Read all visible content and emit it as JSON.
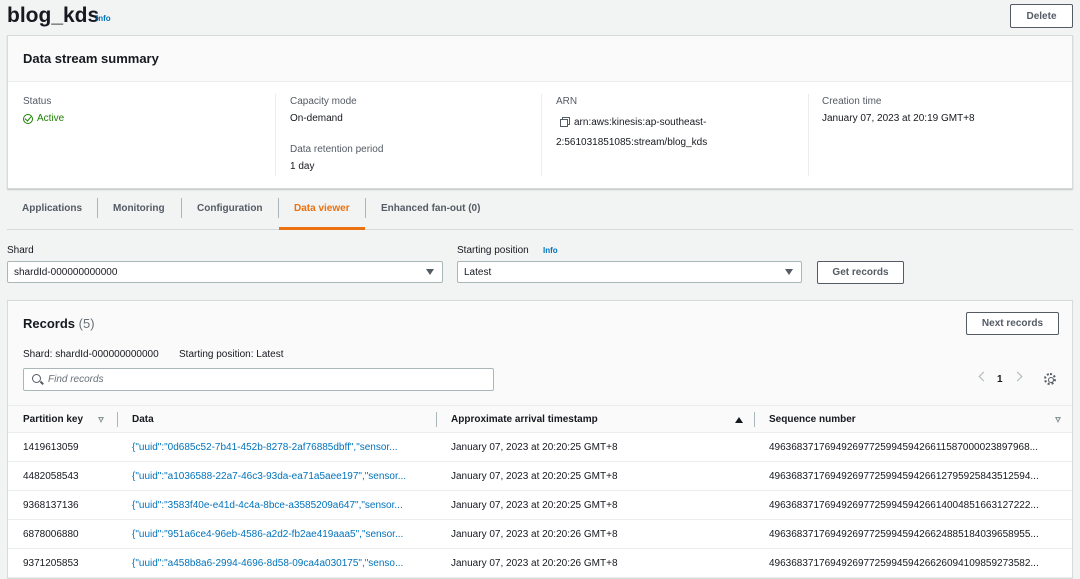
{
  "header": {
    "title": "blog_kds",
    "info": "Info",
    "delete_label": "Delete"
  },
  "summary": {
    "title": "Data stream summary",
    "status_label": "Status",
    "status_value": "Active",
    "capacity_label": "Capacity mode",
    "capacity_value": "On-demand",
    "retention_label": "Data retention period",
    "retention_value": "1 day",
    "arn_label": "ARN",
    "arn_line1": "arn:aws:kinesis:ap-southeast-",
    "arn_line2": "2:561031851085:stream/blog_kds",
    "creation_label": "Creation time",
    "creation_value": "January 07, 2023 at 20:19 GMT+8"
  },
  "tabs": [
    {
      "label": "Applications"
    },
    {
      "label": "Monitoring"
    },
    {
      "label": "Configuration"
    },
    {
      "label": "Data viewer"
    },
    {
      "label": "Enhanced fan-out (0)"
    }
  ],
  "viewer": {
    "shard_label": "Shard",
    "shard_value": "shardId-000000000000",
    "position_label": "Starting position",
    "position_info": "Info",
    "position_value": "Latest",
    "get_records_label": "Get records"
  },
  "records": {
    "title": "Records",
    "count": "(5)",
    "next_label": "Next records",
    "shard_meta": "Shard: shardId-000000000000",
    "position_meta": "Starting position: Latest",
    "search_placeholder": "Find records",
    "page": "1",
    "columns": [
      "Partition key",
      "Data",
      "Approximate arrival timestamp",
      "Sequence number"
    ],
    "rows": [
      {
        "key": "1419613059",
        "data": "{\"uuid\":\"0d685c52-7b41-452b-8278-2af76885dbff\",\"sensor...",
        "time": "January 07, 2023 at 20:20:25 GMT+8",
        "seq": "49636837176949269772599459426611587000023897968..."
      },
      {
        "key": "4482058543",
        "data": "{\"uuid\":\"a1036588-22a7-46c3-93da-ea71a5aee197\",\"sensor...",
        "time": "January 07, 2023 at 20:20:25 GMT+8",
        "seq": "49636837176949269772599459426612795925843512594..."
      },
      {
        "key": "9368137136",
        "data": "{\"uuid\":\"3583f40e-e41d-4c4a-8bce-a3585209a647\",\"sensor...",
        "time": "January 07, 2023 at 20:20:25 GMT+8",
        "seq": "49636837176949269772599459426614004851663127222..."
      },
      {
        "key": "6878006880",
        "data": "{\"uuid\":\"951a6ce4-96eb-4586-a2d2-fb2ae419aaa5\",\"sensor...",
        "time": "January 07, 2023 at 20:20:26 GMT+8",
        "seq": "49636837176949269772599459426624885184039658955..."
      },
      {
        "key": "9371205853",
        "data": "{\"uuid\":\"a458b8a6-2994-4696-8d58-09ca4a030175\",\"senso...",
        "time": "January 07, 2023 at 20:20:26 GMT+8",
        "seq": "49636837176949269772599459426626094109859273582..."
      }
    ]
  }
}
